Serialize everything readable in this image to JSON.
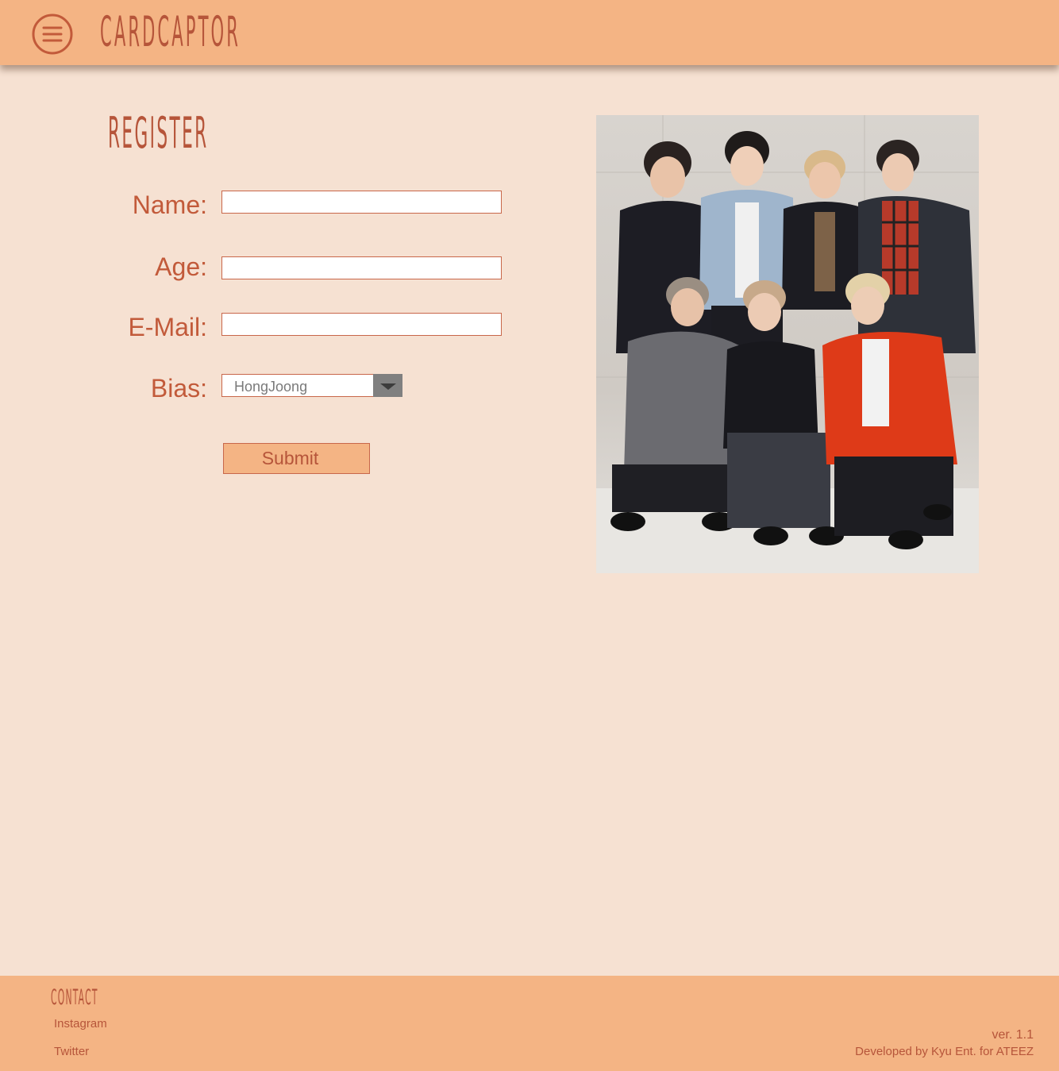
{
  "header": {
    "menu_icon": "hamburger-menu-icon",
    "brand": "CARDCAPTOR"
  },
  "form": {
    "title": "REGISTER",
    "name_label": "Name:",
    "name_value": "",
    "age_label": "Age:",
    "age_value": "",
    "email_label": "E-Mail:",
    "email_value": "",
    "bias_label": "Bias:",
    "bias_value": "HongJoong",
    "bias_icon": "dropdown-arrow-icon",
    "submit_label": "Submit"
  },
  "photo": {
    "alt": "ATEEZ"
  },
  "footer": {
    "contact_title": "CONTACT",
    "links": [
      "Instagram",
      "Twitter"
    ],
    "version": "ver. 1.1",
    "credit": "Developed by Kyu Ent. for ATEEZ"
  },
  "colors": {
    "header_bg": "#f4b484",
    "page_bg": "#f6e1d2",
    "accent_text": "#b6553a",
    "field_border": "#c8674a"
  }
}
